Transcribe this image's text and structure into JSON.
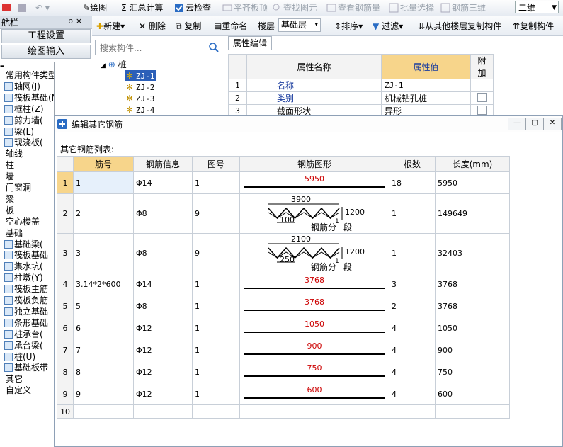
{
  "toolbar": {
    "items": [
      "绘图",
      "Σ 汇总计算",
      "云检查",
      "平齐板顶",
      "查找图元",
      "查看钢筋量",
      "批量选择",
      "钢筋三维"
    ],
    "view_mode": "二维"
  },
  "nav": {
    "title": "航栏",
    "pin": "ᵽ ×",
    "buttons": [
      "工程设置",
      "绘图输入"
    ],
    "tree": [
      {
        "label": "常用构件类型",
        "indent": 0
      },
      {
        "label": "轴网(J)",
        "indent": 1
      },
      {
        "label": "筏板基础(M)",
        "indent": 1
      },
      {
        "label": "框柱(Z)",
        "indent": 1
      },
      {
        "label": "剪力墙(",
        "indent": 1
      },
      {
        "label": "梁(L)",
        "indent": 1
      },
      {
        "label": "现浇板(",
        "indent": 1
      },
      {
        "label": "轴线",
        "indent": 0
      },
      {
        "label": "柱",
        "indent": 0
      },
      {
        "label": "墙",
        "indent": 0
      },
      {
        "label": "门窗洞",
        "indent": 0
      },
      {
        "label": "梁",
        "indent": 0
      },
      {
        "label": "板",
        "indent": 0
      },
      {
        "label": "空心楼盖",
        "indent": 0
      },
      {
        "label": "基础",
        "indent": 0
      },
      {
        "label": "基础梁(",
        "indent": 1
      },
      {
        "label": "筏板基础",
        "indent": 1
      },
      {
        "label": "集水坑(",
        "indent": 1
      },
      {
        "label": "柱墩(Y)",
        "indent": 1
      },
      {
        "label": "筏板主筋",
        "indent": 1
      },
      {
        "label": "筏板负筋",
        "indent": 1
      },
      {
        "label": "独立基础",
        "indent": 1
      },
      {
        "label": "条形基础",
        "indent": 1
      },
      {
        "label": "桩承台(",
        "indent": 1
      },
      {
        "label": "承台梁(",
        "indent": 1
      },
      {
        "label": "桩(U)",
        "indent": 1
      },
      {
        "label": "基础板带",
        "indent": 1
      },
      {
        "label": "其它",
        "indent": 0
      },
      {
        "label": "自定义",
        "indent": 0
      }
    ]
  },
  "toolbar2": {
    "new": "新建",
    "delete": "删除",
    "copy": "复制",
    "rename": "重命名",
    "floor_label": "楼层",
    "floor_value": "基础层",
    "sort": "排序",
    "filter": "过滤",
    "copy_from_other": "从其他楼层复制构件",
    "copy_to_other": "复制构件"
  },
  "search": {
    "placeholder": "搜索构件..."
  },
  "comp_tree": {
    "root": "桩",
    "items": [
      "ZJ-1",
      "ZJ-2",
      "ZJ-3",
      "ZJ-4"
    ]
  },
  "props": {
    "tab": "属性编辑",
    "headers": [
      "属性名称",
      "属性值",
      "附加"
    ],
    "rows": [
      {
        "idx": "1",
        "name": "名称",
        "value": "ZJ-1"
      },
      {
        "idx": "2",
        "name": "类别",
        "value": "机械钻孔桩"
      },
      {
        "idx": "3",
        "name": "截面形状",
        "value": "异形"
      }
    ]
  },
  "dialog": {
    "title": "编辑其它钢筋",
    "subtitle": "其它钢筋列表:",
    "headers": [
      "筋号",
      "钢筋信息",
      "图号",
      "钢筋图形",
      "根数",
      "长度(mm)"
    ],
    "rows": [
      {
        "idx": "1",
        "jin": "1",
        "info": "Φ14",
        "tu": "1",
        "shape": "bar",
        "len_label": "5950",
        "count": "18",
        "length": "5950"
      },
      {
        "idx": "2",
        "jin": "2",
        "info": "Φ8",
        "tu": "9",
        "shape": "spiral",
        "top": "3900",
        "pitch": "100",
        "height": "1200",
        "note": "钢筋分",
        "sup": "1",
        "seg": "段",
        "count": "1",
        "length": "149649"
      },
      {
        "idx": "3",
        "jin": "3",
        "info": "Φ8",
        "tu": "9",
        "shape": "spiral",
        "top": "2100",
        "pitch": "250",
        "height": "1200",
        "note": "钢筋分",
        "sup": "1",
        "seg": "段",
        "count": "1",
        "length": "32403"
      },
      {
        "idx": "4",
        "jin": "3.14*2*600",
        "info": "Φ14",
        "tu": "1",
        "shape": "bar",
        "len_label": "3768",
        "count": "3",
        "length": "3768"
      },
      {
        "idx": "5",
        "jin": "5",
        "info": "Φ8",
        "tu": "1",
        "shape": "bar",
        "len_label": "3768",
        "count": "2",
        "length": "3768"
      },
      {
        "idx": "6",
        "jin": "6",
        "info": "Φ12",
        "tu": "1",
        "shape": "bar",
        "len_label": "1050",
        "count": "4",
        "length": "1050"
      },
      {
        "idx": "7",
        "jin": "7",
        "info": "Φ12",
        "tu": "1",
        "shape": "bar",
        "len_label": "900",
        "count": "4",
        "length": "900"
      },
      {
        "idx": "8",
        "jin": "8",
        "info": "Φ12",
        "tu": "1",
        "shape": "bar",
        "len_label": "750",
        "count": "4",
        "length": "750"
      },
      {
        "idx": "9",
        "jin": "9",
        "info": "Φ12",
        "tu": "1",
        "shape": "bar",
        "len_label": "600",
        "count": "4",
        "length": "600"
      },
      {
        "idx": "10",
        "jin": "",
        "info": "",
        "tu": "",
        "shape": "none",
        "count": "",
        "length": ""
      }
    ]
  },
  "colors": {
    "selected": "#f7d58b",
    "bar_label": "#cc0000",
    "link_blue": "#1a3c9e"
  }
}
